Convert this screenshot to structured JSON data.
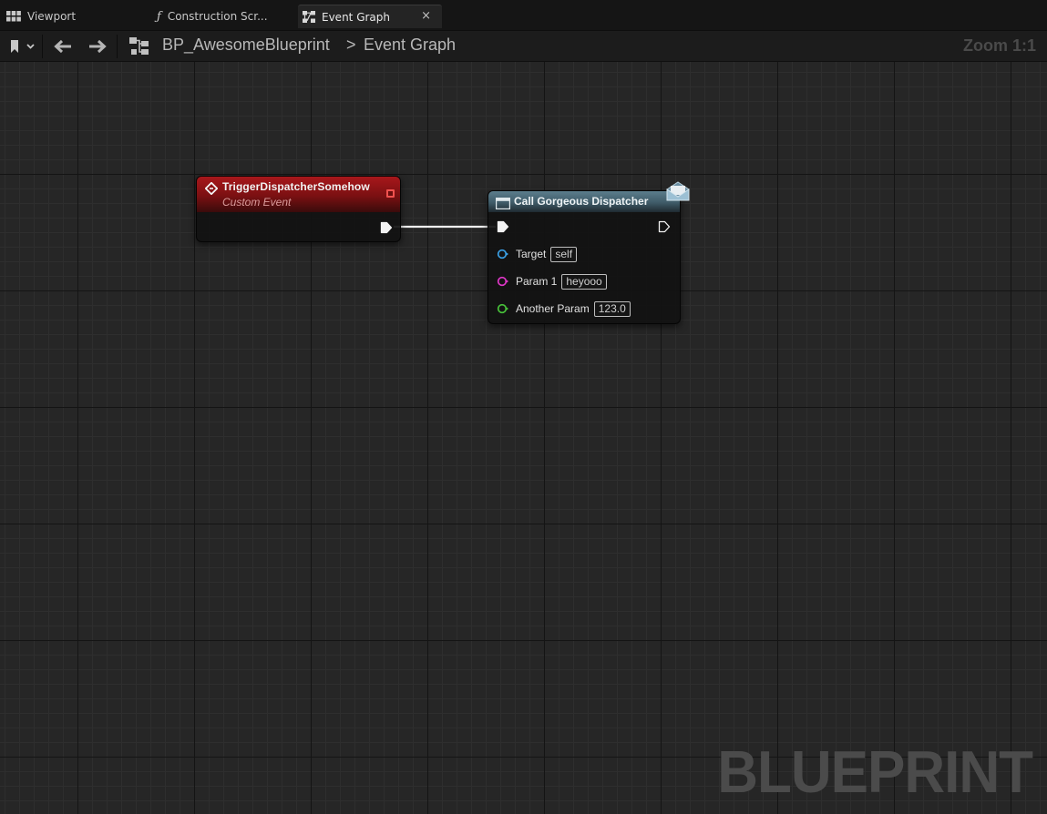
{
  "tabs": [
    {
      "label": "Viewport",
      "icon": "viewport-grid-icon"
    },
    {
      "label": "Construction Scr...",
      "icon": "function-icon",
      "glyph": "ƒ"
    },
    {
      "label": "Event Graph",
      "icon": "event-graph-icon",
      "close": "×",
      "active": true
    }
  ],
  "breadcrumb": {
    "blueprint": "BP_AwesomeBlueprint",
    "separator": ">",
    "graph": "Event Graph"
  },
  "zoom": "Zoom 1:1",
  "watermark": "BLUEPRINT",
  "event_node": {
    "title": "TriggerDispatcherSomehow",
    "subtitle": "Custom Event",
    "header_color": "#a8171b"
  },
  "call_node": {
    "title": "Call Gorgeous Dispatcher",
    "header_color": "#4f6d7a",
    "pins": [
      {
        "label": "Target",
        "value": "self",
        "color": "#3aa0e6"
      },
      {
        "label": "Param 1",
        "value": "heyooo",
        "color": "#e037c8"
      },
      {
        "label": "Another Param",
        "value": "123.0",
        "color": "#48c23a"
      }
    ]
  }
}
